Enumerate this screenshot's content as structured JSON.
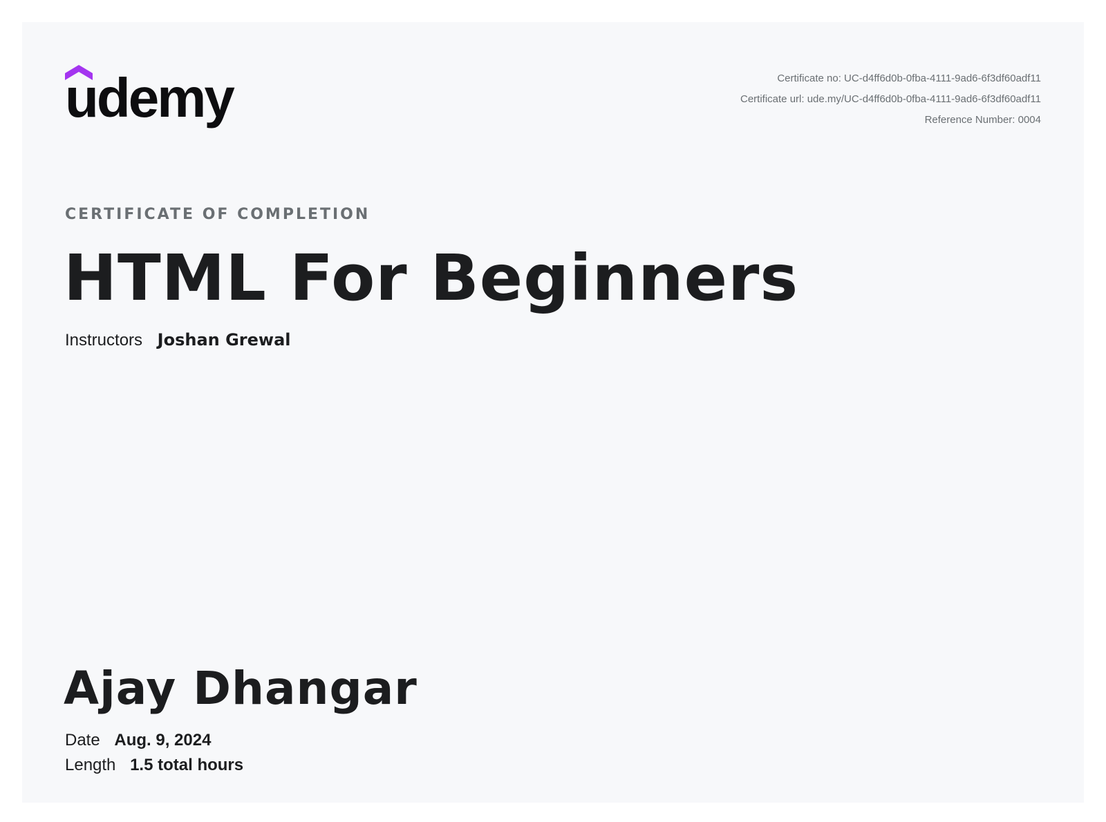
{
  "logo": {
    "text": "udemy",
    "mark_color": "#a435f0",
    "icon": "udemy-logo-icon"
  },
  "meta": {
    "certificate_no": "Certificate no: UC-d4ff6d0b-0fba-4111-9ad6-6f3df60adf11",
    "certificate_url": "Certificate url: ude.my/UC-d4ff6d0b-0fba-4111-9ad6-6f3df60adf11",
    "reference_number": "Reference Number: 0004"
  },
  "eyebrow": "CERTIFICATE OF COMPLETION",
  "course_title": "HTML For Beginners",
  "instructors": {
    "label": "Instructors",
    "value": "Joshan Grewal"
  },
  "student_name": "Ajay Dhangar",
  "date": {
    "label": "Date",
    "value": "Aug. 9, 2024"
  },
  "length": {
    "label": "Length",
    "value": "1.5 total hours"
  },
  "colors": {
    "background": "#f7f8fa",
    "text": "#1c1d1f",
    "muted": "#6a6f73",
    "brand": "#a435f0"
  }
}
